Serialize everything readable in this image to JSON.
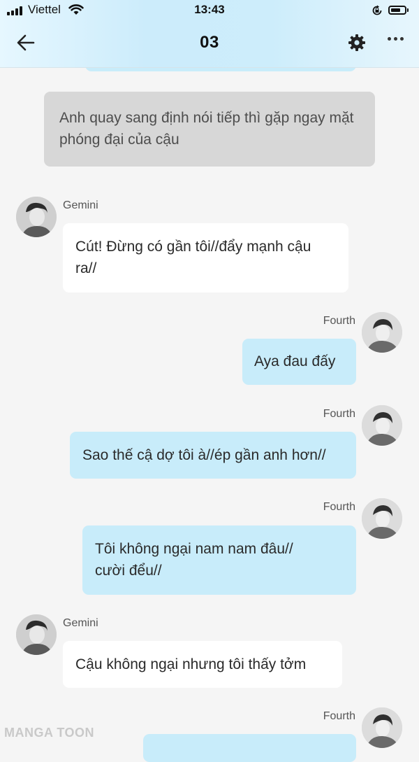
{
  "status_bar": {
    "carrier": "Viettel",
    "time": "13:43",
    "icons": [
      "signal-icon",
      "wifi-icon",
      "orientation-lock-icon",
      "battery-icon"
    ]
  },
  "header": {
    "title": "03",
    "back_icon": "arrow-left-icon",
    "settings_icon": "gear-icon",
    "more_icon": "more-dots-icon"
  },
  "messages": [
    {
      "type": "narration",
      "text": "Anh quay sang định nói tiếp thì gặp ngay mặt phóng đại của cậu"
    },
    {
      "sender": "Gemini",
      "side": "left",
      "text": "Cút! Đừng có gần tôi//đẩy mạnh cậu ra//"
    },
    {
      "sender": "Fourth",
      "side": "right",
      "text": "Aya đau đấy"
    },
    {
      "sender": "Fourth",
      "side": "right",
      "text": "Sao thế cậ dợ tôi à//ép gần anh hơn//"
    },
    {
      "sender": "Fourth",
      "side": "right",
      "text": "Tôi không ngại nam nam đâu// cười đểu//"
    },
    {
      "sender": "Gemini",
      "side": "left",
      "text": "Cậu không ngại nhưng tôi thấy tởm"
    },
    {
      "sender": "Fourth",
      "side": "right",
      "text": ""
    }
  ],
  "watermark": "MANGA TOON",
  "colors": {
    "header_gradient": "#ccecfb",
    "bubble_blue": "#c8ecfa",
    "bubble_white": "#ffffff",
    "bubble_narration": "#d7d7d7",
    "background": "#f5f5f5"
  }
}
